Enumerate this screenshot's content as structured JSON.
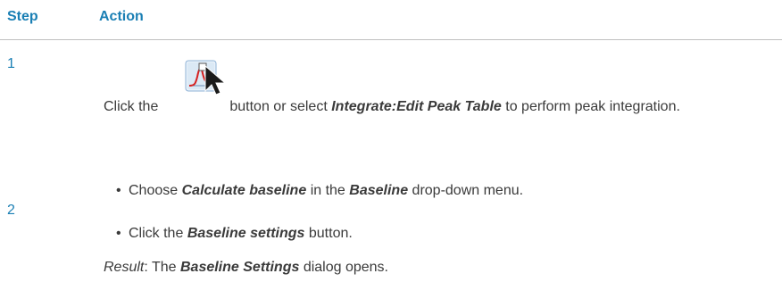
{
  "table": {
    "headers": {
      "step": "Step",
      "action": "Action"
    },
    "rows": [
      {
        "step": "1",
        "icon": "edit-peak-table-icon",
        "text_before": "Click the",
        "text_after": "button or select",
        "command": "Integrate:Edit Peak Table",
        "text_end": "to perform peak integration."
      },
      {
        "step": "2",
        "bullets": [
          {
            "pre": "Choose",
            "bold1": "Calculate baseline",
            "mid": "in the",
            "bold2": "Baseline",
            "post": "drop-down menu."
          },
          {
            "pre": "Click the",
            "bold1": "Baseline settings",
            "post": "button."
          }
        ],
        "result": {
          "label": "Result",
          "pre": ": The",
          "bold": "Baseline Settings",
          "post": "dialog opens."
        }
      }
    ]
  },
  "colors": {
    "heading": "#1a7fb4",
    "text": "#3a3a3a",
    "icon_curve": "#d62020",
    "icon_bg": "#dbe9f5"
  }
}
